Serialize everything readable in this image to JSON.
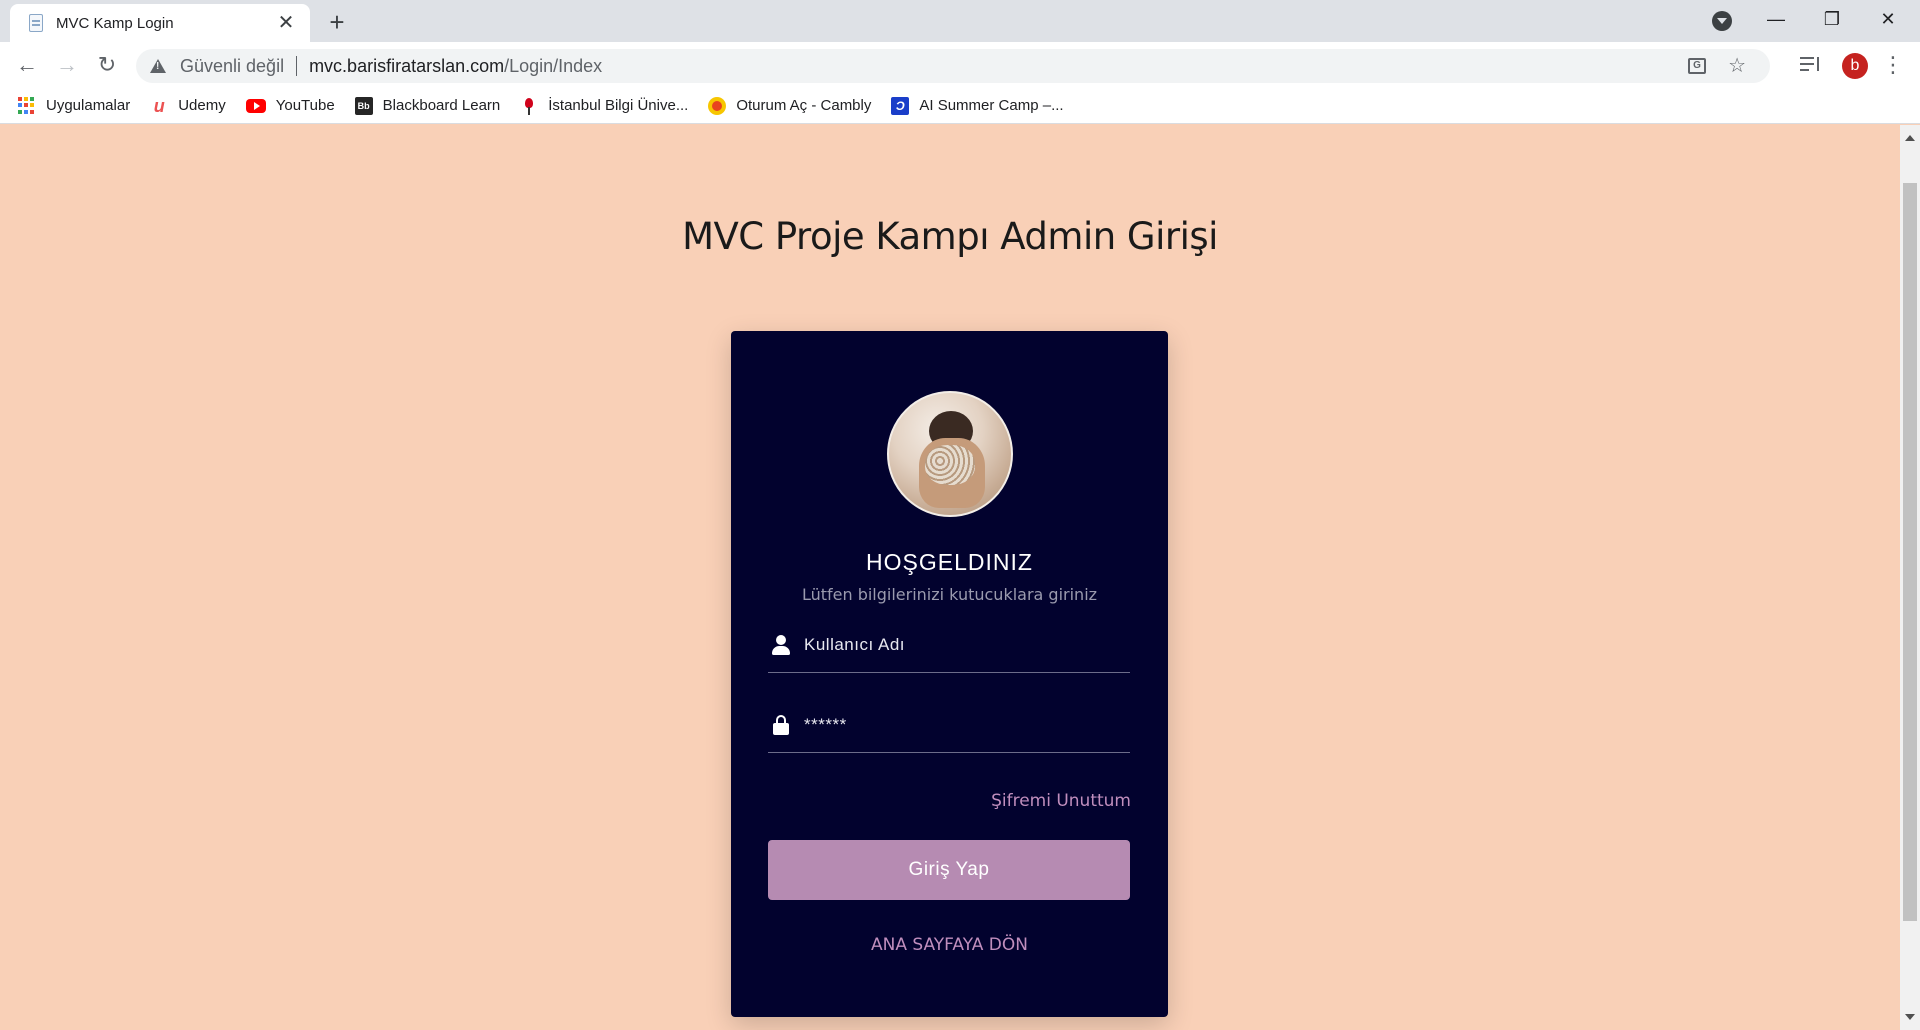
{
  "browser": {
    "tab": {
      "title": "MVC Kamp Login",
      "close_glyph": "✕"
    },
    "new_tab_glyph": "+",
    "window_controls": {
      "minimize": "—",
      "maximize": "❐",
      "close": "✕"
    },
    "nav": {
      "back": "←",
      "forward": "→",
      "reload": "↻"
    },
    "address": {
      "security_label": "Güvenli değil",
      "host": "mvc.barisfiratarslan.com",
      "path": "/Login/Index"
    },
    "star_glyph": "☆",
    "profile_initial": "b",
    "menu_glyph": "⋮",
    "translate_glyph": "G"
  },
  "bookmarks": [
    {
      "label": "Uygulamalar",
      "icon": "apps-grid-icon"
    },
    {
      "label": "Udemy",
      "icon": "udemy-icon"
    },
    {
      "label": "YouTube",
      "icon": "youtube-icon"
    },
    {
      "label": "Blackboard Learn",
      "icon": "blackboard-icon"
    },
    {
      "label": "İstanbul Bilgi Ünive...",
      "icon": "bilgi-university-icon"
    },
    {
      "label": "Oturum Aç - Cambly",
      "icon": "cambly-icon"
    },
    {
      "label": "AI Summer Camp –...",
      "icon": "ai-summer-camp-icon"
    }
  ],
  "apps_colors": [
    "#ea4335",
    "#fbbc05",
    "#34a853",
    "#4285f4",
    "#ea4335",
    "#fbbc05",
    "#34a853",
    "#4285f4",
    "#ea4335"
  ],
  "page": {
    "title": "MVC Proje Kampı Admin Girişi",
    "card": {
      "welcome": "HOŞGELDINIZ",
      "subtitle": "Lütfen bilgilerinizi kutucuklara giriniz",
      "username_placeholder": "Kullanıcı Adı",
      "password_value": "******",
      "forgot_label": "Şifremi Unuttum",
      "login_label": "Giriş Yap",
      "home_label": "ANA SAYFAYA DÖN"
    }
  },
  "colors": {
    "page_bg": "#f9d0b7",
    "card_bg": "#02022e",
    "accent": "#b68bb2",
    "link": "#c08ebd"
  }
}
